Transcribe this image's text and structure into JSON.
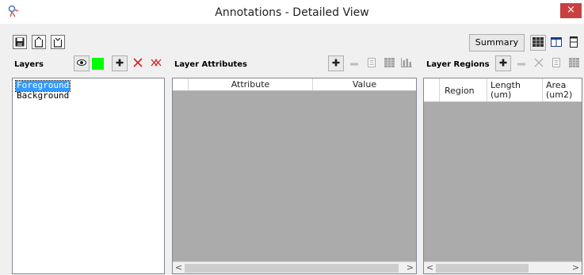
{
  "window": {
    "title": "Annotations - Detailed View",
    "close_label": "×"
  },
  "toolbar": {
    "summary_label": "Summary"
  },
  "colors": {
    "layer_color": "#00ff00",
    "selection": "#3399ff",
    "close": "#c94040"
  },
  "layers": {
    "label": "Layers",
    "items": [
      {
        "label": "Foreground",
        "selected": true
      },
      {
        "label": "Background",
        "selected": false
      }
    ]
  },
  "attributes": {
    "label": "Layer Attributes",
    "columns": [
      "Attribute",
      "Value"
    ]
  },
  "regions": {
    "label": "Layer Regions",
    "columns": [
      {
        "line1": "Region",
        "line2": ""
      },
      {
        "line1": "Length",
        "line2": "(um)"
      },
      {
        "line1": "Area",
        "line2": "(um2)"
      }
    ]
  },
  "scroll": {
    "left": "<",
    "right": ">"
  }
}
